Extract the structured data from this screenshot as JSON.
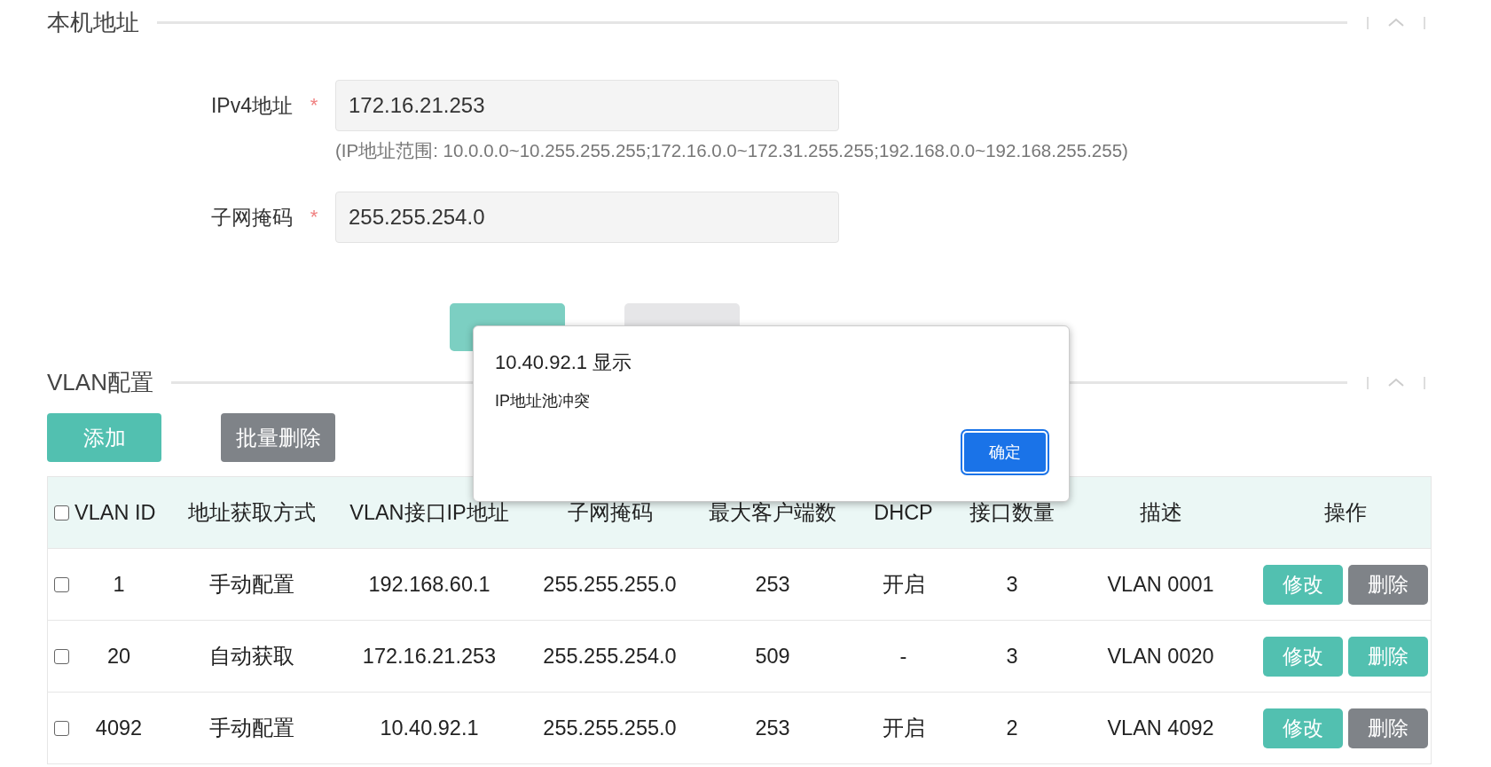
{
  "local_address": {
    "title": "本机地址",
    "fields": [
      {
        "label": "IPv4地址",
        "required_mark": "*",
        "value": "172.16.21.253",
        "hint": "(IP地址范围: 10.0.0.0~10.255.255.255;172.16.0.0~172.31.255.255;192.168.0.0~192.168.255.255)"
      },
      {
        "label": "子网掩码",
        "required_mark": "*",
        "value": "255.255.254.0"
      }
    ]
  },
  "vlan": {
    "title": "VLAN配置",
    "buttons": [
      "添加",
      "批量删除"
    ],
    "table": {
      "select_all_checked": false,
      "columns": [
        "VLAN ID",
        "地址获取方式",
        "VLAN接口IP地址",
        "子网掩码",
        "最大客户端数",
        "DHCP",
        "接口数量",
        "描述",
        "操作"
      ],
      "rows": [
        {
          "checked": false,
          "cells": [
            "1",
            "手动配置",
            "192.168.60.1",
            "255.255.255.0",
            "253",
            "开启",
            "3",
            "VLAN 0001"
          ],
          "edit": "修改",
          "delete": "删除",
          "delete_disabled": true
        },
        {
          "checked": false,
          "cells": [
            "20",
            "自动获取",
            "172.16.21.253",
            "255.255.254.0",
            "509",
            "-",
            "3",
            "VLAN 0020"
          ],
          "edit": "修改",
          "delete": "删除",
          "delete_disabled": false
        },
        {
          "checked": false,
          "cells": [
            "4092",
            "手动配置",
            "10.40.92.1",
            "255.255.255.0",
            "253",
            "开启",
            "2",
            "VLAN 4092"
          ],
          "edit": "修改",
          "delete": "删除",
          "delete_disabled": true
        }
      ]
    }
  },
  "dialog": {
    "title": "10.40.92.1 显示",
    "message": "IP地址池冲突",
    "button": "确定"
  }
}
